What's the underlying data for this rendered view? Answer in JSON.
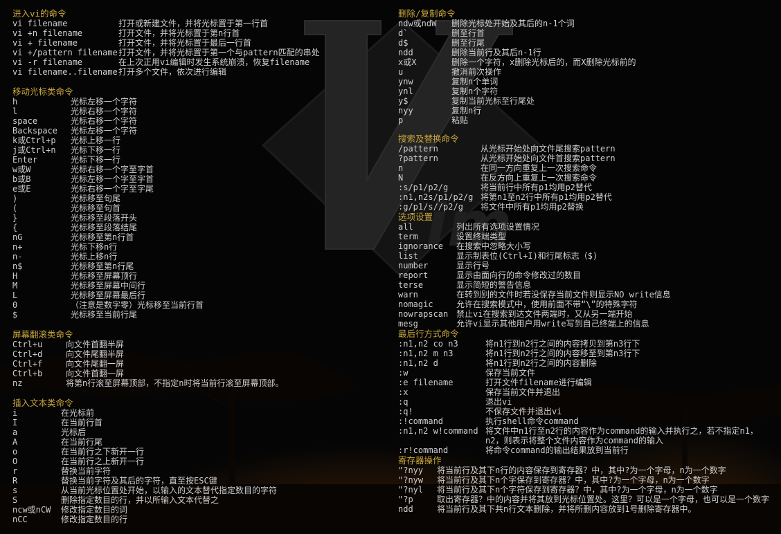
{
  "colors": {
    "heading": "#c8a53a",
    "text": "#cfcfcf",
    "background": "#050505"
  },
  "sections": {
    "open": {
      "title": "进入vi的命令",
      "items": [
        {
          "cmd": "vi filename",
          "desc": "打开或新建文件，并将光标置于第一行首"
        },
        {
          "cmd": "vi +n filename",
          "desc": "打开文件，并将光标置于第n行首"
        },
        {
          "cmd": "vi + filename",
          "desc": "打开文件，并将光标置于最后一行首"
        },
        {
          "cmd": "vi +/pattern filename",
          "desc": "打开文件，并将光标置于第一个与pattern匹配的串处"
        },
        {
          "cmd": "vi -r filename",
          "desc": "在上次正用vi编辑时发生系统崩溃，恢复filename"
        },
        {
          "cmd": "vi filename..filename",
          "desc": "打开多个文件，依次进行编辑"
        }
      ]
    },
    "move": {
      "title": "移动光标类命令",
      "items": [
        {
          "cmd": "h",
          "desc": "光标左移一个字符"
        },
        {
          "cmd": "l",
          "desc": "光标右移一个字符"
        },
        {
          "cmd": "space",
          "desc": "光标右移一个字符"
        },
        {
          "cmd": "Backspace",
          "desc": "光标左移一个字符"
        },
        {
          "cmd": "k或Ctrl+p",
          "desc": "光标上移一行"
        },
        {
          "cmd": "j或Ctrl+n",
          "desc": "光标下移一行"
        },
        {
          "cmd": "Enter",
          "desc": "光标下移一行"
        },
        {
          "cmd": "w或W",
          "desc": "光标右移一个字至字首"
        },
        {
          "cmd": "b或B",
          "desc": "光标左移一个字至字首"
        },
        {
          "cmd": "e或E",
          "desc": "光标右移一个字至字尾"
        },
        {
          "cmd": ")",
          "desc": "光标移至句尾"
        },
        {
          "cmd": "(",
          "desc": "光标移至句首"
        },
        {
          "cmd": "}",
          "desc": "光标移至段落开头"
        },
        {
          "cmd": "{",
          "desc": "光标移至段落结尾"
        },
        {
          "cmd": "nG",
          "desc": "光标移至第n行首"
        },
        {
          "cmd": "n+",
          "desc": "光标下移n行"
        },
        {
          "cmd": "n-",
          "desc": "光标上移n行"
        },
        {
          "cmd": "n$",
          "desc": "光标移至第n行尾"
        },
        {
          "cmd": "H",
          "desc": "光标移至屏幕顶行"
        },
        {
          "cmd": "M",
          "desc": "光标移至屏幕中间行"
        },
        {
          "cmd": "L",
          "desc": "光标移至屏幕最后行"
        },
        {
          "cmd": "0",
          "desc": "（注意是数字零）光标移至当前行首"
        },
        {
          "cmd": "$",
          "desc": "光标移至当前行尾"
        }
      ]
    },
    "scroll": {
      "title": "屏幕翻滚类命令",
      "items": [
        {
          "cmd": "Ctrl+u",
          "desc": "向文件首翻半屏"
        },
        {
          "cmd": "Ctrl+d",
          "desc": "向文件尾翻半屏"
        },
        {
          "cmd": "Ctrl+f",
          "desc": "向文件尾翻一屏"
        },
        {
          "cmd": "Ctrl+b",
          "desc": "向文件首翻一屏"
        },
        {
          "cmd": "nz",
          "desc": "将第n行滚至屏幕顶部，不指定n时将当前行滚至屏幕顶部。"
        }
      ]
    },
    "insert": {
      "title": "插入文本类命令",
      "items": [
        {
          "cmd": "i",
          "desc": "在光标前"
        },
        {
          "cmd": "I",
          "desc": "在当前行首"
        },
        {
          "cmd": "a",
          "desc": "光标后"
        },
        {
          "cmd": "A",
          "desc": "在当前行尾"
        },
        {
          "cmd": "o",
          "desc": "在当前行之下新开一行"
        },
        {
          "cmd": "O",
          "desc": "在当前行之上新开一行"
        },
        {
          "cmd": "r",
          "desc": "替换当前字符"
        },
        {
          "cmd": "R",
          "desc": "替换当前字符及其后的字符，直至按ESC键"
        },
        {
          "cmd": "s",
          "desc": "从当前光标位置处开始，以输入的文本替代指定数目的字符"
        },
        {
          "cmd": "S",
          "desc": "删除指定数目的行，并以所输入文本代替之"
        },
        {
          "cmd": "ncw或nCW",
          "desc": "修改指定数目的词"
        },
        {
          "cmd": "nCC",
          "desc": "修改指定数目的行"
        }
      ]
    },
    "delete": {
      "title": "删除/复制命令",
      "items": [
        {
          "cmd": "ndw或ndW",
          "desc": "删除光标处开始及其后的n-1个词"
        },
        {
          "cmd": "d`",
          "desc": "删至行首"
        },
        {
          "cmd": "d$",
          "desc": "删至行尾"
        },
        {
          "cmd": "ndd",
          "desc": "删除当前行及其后n-1行"
        },
        {
          "cmd": "x或X",
          "desc": "删除一个字符，x删除光标后的，而X删除光标前的"
        },
        {
          "cmd": "u",
          "desc": "撤消前次操作"
        },
        {
          "cmd": "ynw",
          "desc": "复制n个单词"
        },
        {
          "cmd": "ynl",
          "desc": "复制n个字符"
        },
        {
          "cmd": "y$",
          "desc": "复制当前光标至行尾处"
        },
        {
          "cmd": "nyy",
          "desc": "复制n行"
        },
        {
          "cmd": "p",
          "desc": "粘贴"
        }
      ]
    },
    "search": {
      "title": "搜索及替换命令",
      "items": [
        {
          "cmd": "/pattern",
          "desc": "从光标开始处向文件尾搜索pattern"
        },
        {
          "cmd": "?pattern",
          "desc": "从光标开始处向文件首搜索pattern"
        },
        {
          "cmd": "n",
          "desc": "在同一方向重复上一次搜索命令"
        },
        {
          "cmd": "N",
          "desc": "在反方向上重复上一次搜索命令"
        },
        {
          "cmd": ":s/p1/p2/g",
          "desc": "将当前行中所有p1均用p2替代"
        },
        {
          "cmd": ":n1,n2s/p1/p2/g",
          "desc": "将第n1至n2行中所有p1均用p2替代"
        },
        {
          "cmd": ":g/p1/s//p2/g",
          "desc": "将文件中所有p1均用p2替换"
        }
      ]
    },
    "options": {
      "title": "选项设置",
      "items": [
        {
          "cmd": "all",
          "desc": "列出所有选项设置情况"
        },
        {
          "cmd": "term",
          "desc": "设置终端类型"
        },
        {
          "cmd": "ignorance",
          "desc": "在搜索中忽略大小写"
        },
        {
          "cmd": "list",
          "desc": "显示制表位(Ctrl+I)和行尾标志（$)"
        },
        {
          "cmd": "number",
          "desc": "显示行号"
        },
        {
          "cmd": "report",
          "desc": "显示由面向行的命令修改过的数目"
        },
        {
          "cmd": "terse",
          "desc": "显示简短的警告信息"
        },
        {
          "cmd": "warn",
          "desc": "在转到别的文件时若没保存当前文件则显示NO write信息"
        },
        {
          "cmd": "nomagic",
          "desc": "允许在搜索模式中，使用前面不带“\\”的特殊字符"
        },
        {
          "cmd": "nowrapscan",
          "desc": "禁止vi在搜索到达文件两端时，又从另一端开始"
        },
        {
          "cmd": "mesg",
          "desc": "允许vi显示其他用户用write写到自己终端上的信息"
        }
      ]
    },
    "lastline": {
      "title": "最后行方式命令",
      "items": [
        {
          "cmd": ":n1,n2 co n3",
          "desc": "将n1行到n2行之间的内容拷贝到第n3行下"
        },
        {
          "cmd": ":n1,n2 m n3",
          "desc": "将n1行到n2行之间的内容移至到第n3行下"
        },
        {
          "cmd": ":n1,n2 d",
          "desc": "将n1行到n2行之间的内容删除"
        },
        {
          "cmd": ":w",
          "desc": "保存当前文件"
        },
        {
          "cmd": ":e filename",
          "desc": "打开文件filename进行编辑"
        },
        {
          "cmd": ":x",
          "desc": "保存当前文件并退出"
        },
        {
          "cmd": ":q",
          "desc": "退出vi"
        },
        {
          "cmd": ":q!",
          "desc": "不保存文件并退出vi"
        },
        {
          "cmd": ":!command",
          "desc": "执行shell命令command"
        },
        {
          "cmd": ":n1,n2 w!command",
          "desc": "将文件中n1行至n2行的内容作为command的输入并执行之，若不指定n1，n2，则表示将整个文件内容作为command的输入"
        },
        {
          "cmd": ":r!command",
          "desc": "将命令command的输出结果放到当前行"
        }
      ]
    },
    "register": {
      "title": "寄存器操作",
      "items": [
        {
          "cmd": "\"?nyy",
          "desc": "将当前行及其下n行的内容保存到寄存器？中，其中?为一个字母，n为一个数字"
        },
        {
          "cmd": "\"?nyw",
          "desc": "将当前行及其下n个字保存到寄存器？中，其中?为一个字母，n为一个数字"
        },
        {
          "cmd": "\"?nyl",
          "desc": "将当前行及其下n个字符保存到寄存器？中，其中?为一个字母，n为一个数字"
        },
        {
          "cmd": "\"?p",
          "desc": "取出寄存器？中的内容并将其放到光标位置处。这里？可以是一个字母，也可以是一个数字"
        },
        {
          "cmd": "ndd",
          "desc": "将当前行及其下共n行文本删除，并将所删内容放到1号删除寄存器中。"
        }
      ]
    }
  }
}
